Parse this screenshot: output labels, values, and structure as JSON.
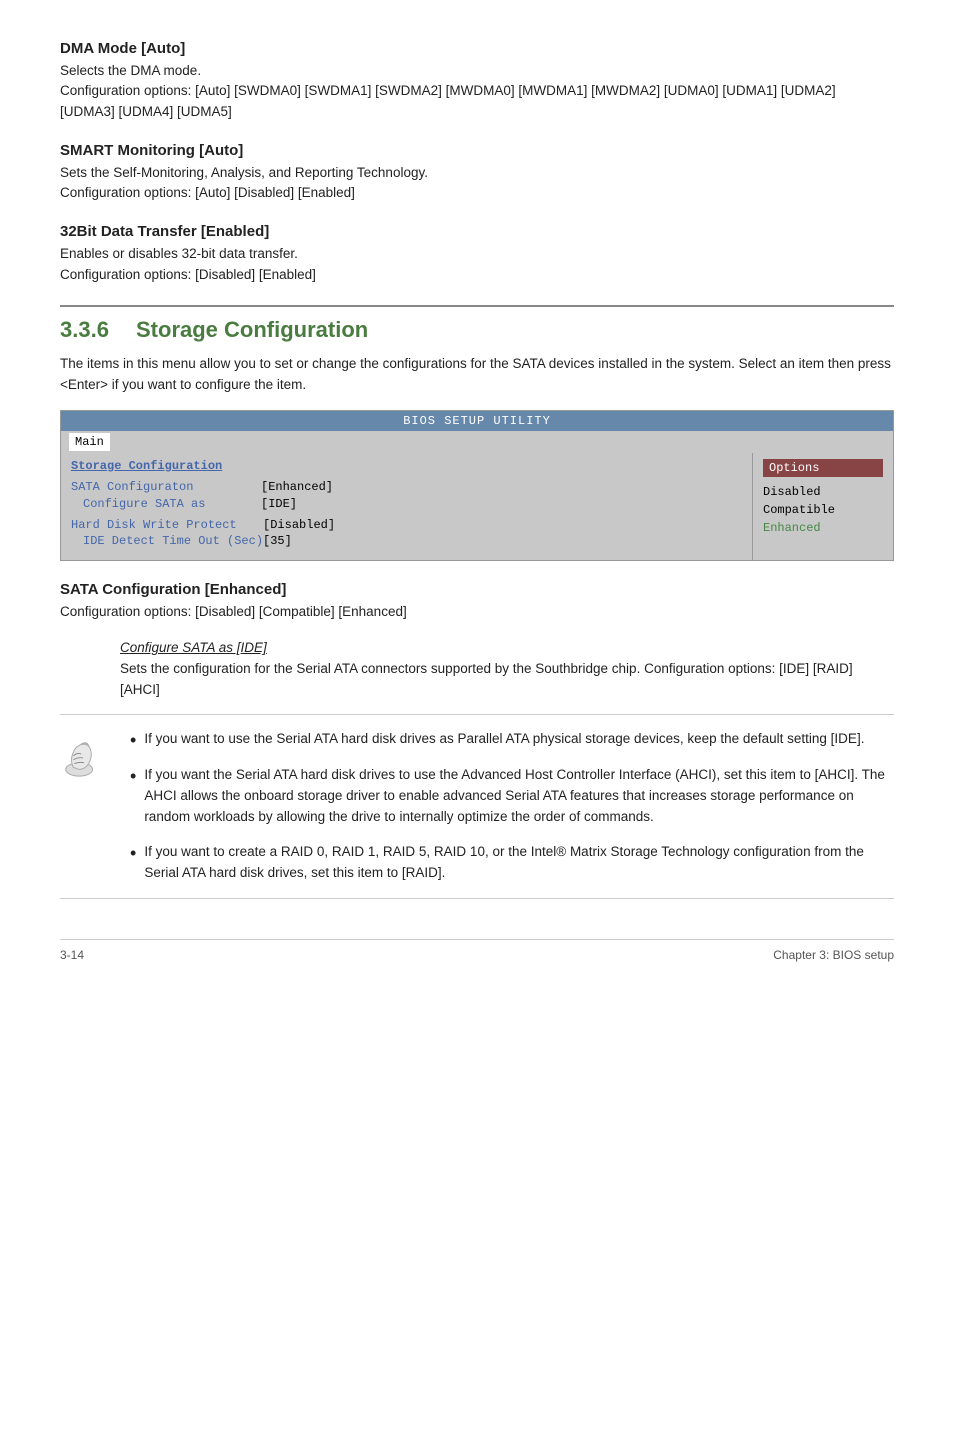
{
  "page": {
    "footer_left": "3-14",
    "footer_right": "Chapter 3: BIOS setup"
  },
  "sections": [
    {
      "id": "dma-mode",
      "title": "DMA Mode [Auto]",
      "desc_lines": [
        "Selects the DMA mode.",
        "Configuration options: [Auto] [SWDMA0] [SWDMA1] [SWDMA2] [MWDMA0] [MWDMA1] [MWDMA2] [UDMA0] [UDMA1] [UDMA2] [UDMA3] [UDMA4] [UDMA5]"
      ]
    },
    {
      "id": "smart-monitoring",
      "title": "SMART Monitoring [Auto]",
      "desc_lines": [
        "Sets the Self-Monitoring, Analysis, and Reporting Technology.",
        "Configuration options: [Auto] [Disabled] [Enabled]"
      ]
    },
    {
      "id": "32bit-data",
      "title": "32Bit Data Transfer [Enabled]",
      "desc_lines": [
        "Enables or disables 32-bit data transfer.",
        "Configuration options: [Disabled] [Enabled]"
      ]
    }
  ],
  "storage_section": {
    "number": "3.3.6",
    "title": "Storage Configuration",
    "intro": "The items in this menu allow you to set or change the configurations for the SATA devices installed in the system. Select an item then press <Enter> if you want to configure the item.",
    "bios": {
      "title_bar": "BIOS SETUP UTILITY",
      "menu_items": [
        "Main"
      ],
      "active_menu": "Main",
      "section_label": "Storage Configuration",
      "options_label": "Options",
      "rows": [
        {
          "label": "SATA Configuraton",
          "sublabel": "Configure SATA as",
          "value1": "[Enhanced]",
          "value2": "[IDE]"
        },
        {
          "label": "Hard Disk Write Protect",
          "sublabel": "IDE Detect Time Out (Sec)",
          "value1": "[Disabled]",
          "value2": "[35]"
        }
      ],
      "option_items": [
        {
          "text": "Disabled",
          "highlighted": false
        },
        {
          "text": "Compatible",
          "highlighted": false
        },
        {
          "text": "Enhanced",
          "highlighted": true
        }
      ]
    }
  },
  "sata_config": {
    "title": "SATA Configuration [Enhanced]",
    "config_options": "Configuration options: [Disabled] [Compatible] [Enhanced]",
    "sub_title": "Configure SATA as [IDE]",
    "sub_desc": "Sets the configuration for the Serial ATA connectors supported by the Southbridge chip. Configuration options: [IDE] [RAID] [AHCI]"
  },
  "notes": [
    {
      "text": "If you want to use the Serial ATA hard disk drives as Parallel ATA physical storage devices, keep the default setting [IDE]."
    },
    {
      "text": "If you want the Serial ATA hard disk drives to use the Advanced Host Controller Interface (AHCI), set this item to [AHCI]. The AHCI allows the onboard storage driver to enable advanced Serial ATA features that increases storage performance on random workloads by allowing the drive to internally optimize the order of commands."
    },
    {
      "text": "If you want to create a RAID 0, RAID 1, RAID 5, RAID 10, or the Intel® Matrix Storage Technology configuration from the Serial ATA hard disk drives, set this item to [RAID]."
    }
  ]
}
